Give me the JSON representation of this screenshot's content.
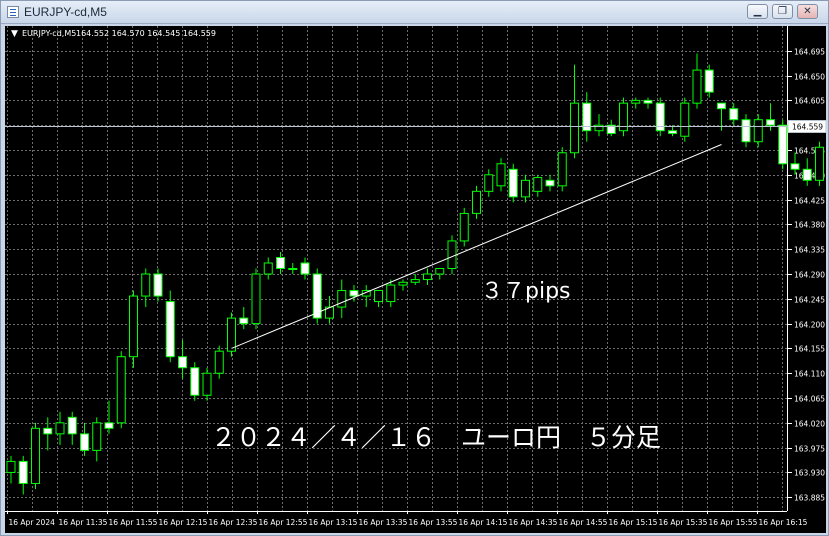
{
  "window": {
    "title": "EURJPY-cd,M5",
    "buttons": {
      "minimize": "▁",
      "restore": "❐",
      "close": "✕"
    }
  },
  "chart": {
    "header_arrow": "▼",
    "header_symbol": "EURJPY-cd,M5",
    "header_ohlc": "164.552 164.570 164.545 164.559",
    "current_price": "164.559",
    "annotation_range": "３７pips",
    "annotation_title": "２０２４／４／１６　ユーロ円　５分足",
    "colors": {
      "background": "#000000",
      "grid": "#6e6e6e",
      "bull_body": "#000000",
      "bear_body": "#ffffff",
      "candle_outline": "#00ff00",
      "trendline": "#ffffff",
      "axis_text": "#ffffff"
    }
  },
  "chart_data": {
    "type": "candlestick",
    "symbol": "EURJPY-cd",
    "timeframe": "M5",
    "ylim": [
      163.86,
      164.74
    ],
    "y_ticks": [
      "164.695",
      "164.650",
      "164.605",
      "164.560",
      "164.515",
      "164.470",
      "164.425",
      "164.380",
      "164.335",
      "164.290",
      "164.245",
      "164.200",
      "164.155",
      "164.110",
      "164.065",
      "164.020",
      "163.975",
      "163.930",
      "163.885"
    ],
    "x_ticks": [
      "16 Apr 2024",
      "16 Apr 11:35",
      "16 Apr 11:55",
      "16 Apr 12:15",
      "16 Apr 12:35",
      "16 Apr 12:55",
      "16 Apr 13:15",
      "16 Apr 13:35",
      "16 Apr 13:55",
      "16 Apr 14:15",
      "16 Apr 14:35",
      "16 Apr 14:55",
      "16 Apr 15:15",
      "16 Apr 15:35",
      "16 Apr 15:55",
      "16 Apr 16:15"
    ],
    "current_price": 164.559,
    "trendline": {
      "from_index": 18,
      "from_price": 164.155,
      "to_index": 58,
      "to_price": 164.525
    },
    "candles": [
      {
        "o": 163.93,
        "h": 163.96,
        "l": 163.91,
        "c": 163.95
      },
      {
        "o": 163.95,
        "h": 163.96,
        "l": 163.89,
        "c": 163.91
      },
      {
        "o": 163.91,
        "h": 164.02,
        "l": 163.9,
        "c": 164.01
      },
      {
        "o": 164.01,
        "h": 164.03,
        "l": 163.97,
        "c": 164.0
      },
      {
        "o": 164.0,
        "h": 164.04,
        "l": 163.98,
        "c": 164.02
      },
      {
        "o": 164.03,
        "h": 164.04,
        "l": 163.98,
        "c": 164.0
      },
      {
        "o": 164.0,
        "h": 164.02,
        "l": 163.96,
        "c": 163.97
      },
      {
        "o": 163.97,
        "h": 164.03,
        "l": 163.95,
        "c": 164.02
      },
      {
        "o": 164.02,
        "h": 164.06,
        "l": 164.0,
        "c": 164.01
      },
      {
        "o": 164.02,
        "h": 164.15,
        "l": 164.01,
        "c": 164.14
      },
      {
        "o": 164.14,
        "h": 164.26,
        "l": 164.12,
        "c": 164.25
      },
      {
        "o": 164.25,
        "h": 164.3,
        "l": 164.23,
        "c": 164.29
      },
      {
        "o": 164.29,
        "h": 164.3,
        "l": 164.24,
        "c": 164.25
      },
      {
        "o": 164.24,
        "h": 164.26,
        "l": 164.13,
        "c": 164.14
      },
      {
        "o": 164.14,
        "h": 164.17,
        "l": 164.1,
        "c": 164.12
      },
      {
        "o": 164.12,
        "h": 164.13,
        "l": 164.06,
        "c": 164.07
      },
      {
        "o": 164.07,
        "h": 164.12,
        "l": 164.06,
        "c": 164.11
      },
      {
        "o": 164.11,
        "h": 164.16,
        "l": 164.1,
        "c": 164.15
      },
      {
        "o": 164.15,
        "h": 164.22,
        "l": 164.14,
        "c": 164.21
      },
      {
        "o": 164.21,
        "h": 164.23,
        "l": 164.19,
        "c": 164.2
      },
      {
        "o": 164.2,
        "h": 164.3,
        "l": 164.19,
        "c": 164.29
      },
      {
        "o": 164.29,
        "h": 164.32,
        "l": 164.28,
        "c": 164.31
      },
      {
        "o": 164.32,
        "h": 164.33,
        "l": 164.29,
        "c": 164.3
      },
      {
        "o": 164.3,
        "h": 164.31,
        "l": 164.29,
        "c": 164.3
      },
      {
        "o": 164.31,
        "h": 164.32,
        "l": 164.28,
        "c": 164.29
      },
      {
        "o": 164.29,
        "h": 164.3,
        "l": 164.2,
        "c": 164.21
      },
      {
        "o": 164.21,
        "h": 164.25,
        "l": 164.2,
        "c": 164.23
      },
      {
        "o": 164.23,
        "h": 164.28,
        "l": 164.21,
        "c": 164.26
      },
      {
        "o": 164.26,
        "h": 164.27,
        "l": 164.24,
        "c": 164.25
      },
      {
        "o": 164.25,
        "h": 164.27,
        "l": 164.23,
        "c": 164.26
      },
      {
        "o": 164.24,
        "h": 164.26,
        "l": 164.23,
        "c": 164.26
      },
      {
        "o": 164.24,
        "h": 164.28,
        "l": 164.23,
        "c": 164.27
      },
      {
        "o": 164.27,
        "h": 164.28,
        "l": 164.26,
        "c": 164.275
      },
      {
        "o": 164.275,
        "h": 164.29,
        "l": 164.27,
        "c": 164.28
      },
      {
        "o": 164.28,
        "h": 164.3,
        "l": 164.27,
        "c": 164.29
      },
      {
        "o": 164.29,
        "h": 164.3,
        "l": 164.28,
        "c": 164.3
      },
      {
        "o": 164.3,
        "h": 164.36,
        "l": 164.29,
        "c": 164.35
      },
      {
        "o": 164.35,
        "h": 164.41,
        "l": 164.34,
        "c": 164.4
      },
      {
        "o": 164.4,
        "h": 164.45,
        "l": 164.39,
        "c": 164.44
      },
      {
        "o": 164.44,
        "h": 164.48,
        "l": 164.43,
        "c": 164.47
      },
      {
        "o": 164.45,
        "h": 164.5,
        "l": 164.44,
        "c": 164.49
      },
      {
        "o": 164.48,
        "h": 164.49,
        "l": 164.42,
        "c": 164.43
      },
      {
        "o": 164.43,
        "h": 164.47,
        "l": 164.42,
        "c": 164.46
      },
      {
        "o": 164.44,
        "h": 164.47,
        "l": 164.43,
        "c": 164.465
      },
      {
        "o": 164.46,
        "h": 164.47,
        "l": 164.44,
        "c": 164.45
      },
      {
        "o": 164.45,
        "h": 164.52,
        "l": 164.44,
        "c": 164.51
      },
      {
        "o": 164.51,
        "h": 164.67,
        "l": 164.5,
        "c": 164.6
      },
      {
        "o": 164.6,
        "h": 164.62,
        "l": 164.53,
        "c": 164.55
      },
      {
        "o": 164.55,
        "h": 164.58,
        "l": 164.54,
        "c": 164.56
      },
      {
        "o": 164.56,
        "h": 164.57,
        "l": 164.54,
        "c": 164.545
      },
      {
        "o": 164.55,
        "h": 164.61,
        "l": 164.54,
        "c": 164.6
      },
      {
        "o": 164.6,
        "h": 164.61,
        "l": 164.59,
        "c": 164.605
      },
      {
        "o": 164.605,
        "h": 164.61,
        "l": 164.59,
        "c": 164.6
      },
      {
        "o": 164.6,
        "h": 164.61,
        "l": 164.54,
        "c": 164.55
      },
      {
        "o": 164.55,
        "h": 164.56,
        "l": 164.54,
        "c": 164.545
      },
      {
        "o": 164.54,
        "h": 164.61,
        "l": 164.53,
        "c": 164.6
      },
      {
        "o": 164.6,
        "h": 164.69,
        "l": 164.59,
        "c": 164.66
      },
      {
        "o": 164.66,
        "h": 164.67,
        "l": 164.61,
        "c": 164.62
      },
      {
        "o": 164.6,
        "h": 164.6,
        "l": 164.55,
        "c": 164.59
      },
      {
        "o": 164.59,
        "h": 164.6,
        "l": 164.56,
        "c": 164.57
      },
      {
        "o": 164.57,
        "h": 164.58,
        "l": 164.52,
        "c": 164.53
      },
      {
        "o": 164.53,
        "h": 164.58,
        "l": 164.52,
        "c": 164.57
      },
      {
        "o": 164.57,
        "h": 164.6,
        "l": 164.55,
        "c": 164.56
      },
      {
        "o": 164.56,
        "h": 164.57,
        "l": 164.48,
        "c": 164.49
      },
      {
        "o": 164.49,
        "h": 164.51,
        "l": 164.47,
        "c": 164.48
      },
      {
        "o": 164.48,
        "h": 164.5,
        "l": 164.45,
        "c": 164.46
      },
      {
        "o": 164.46,
        "h": 164.53,
        "l": 164.45,
        "c": 164.52
      }
    ]
  }
}
